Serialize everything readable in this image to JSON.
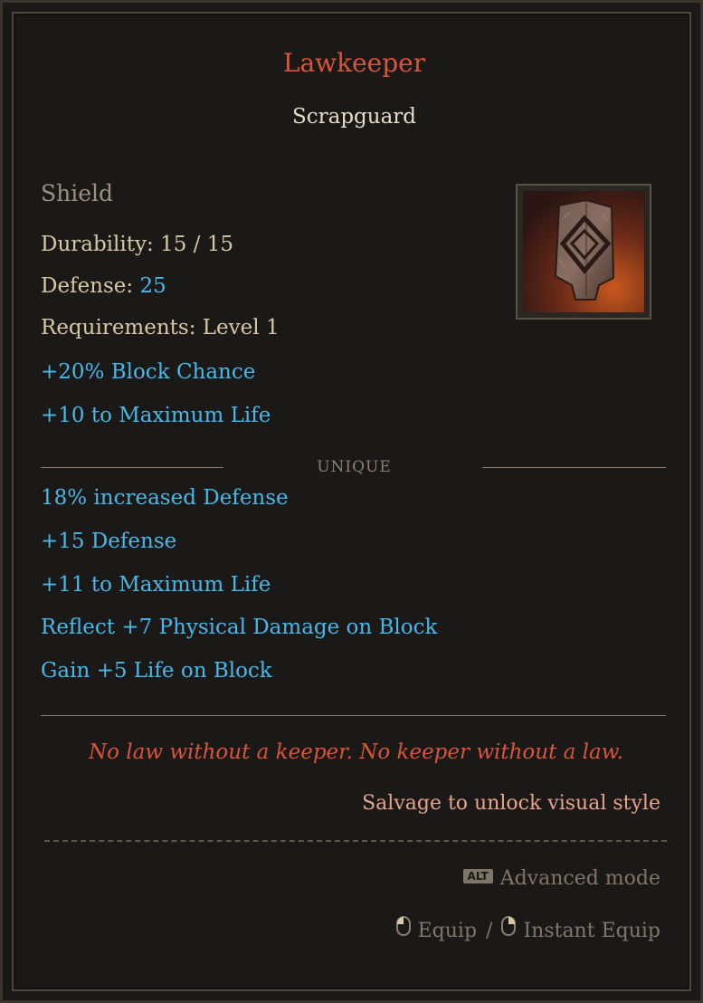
{
  "item": {
    "name": "Lawkeeper",
    "base": "Scrapguard",
    "type": "Shield",
    "icon": "shield-icon"
  },
  "stats": {
    "durability_label": "Durability:",
    "durability_value": "15 / 15",
    "defense_label": "Defense:",
    "defense_value": "25",
    "requirements_label": "Requirements:",
    "requirements_value": "Level 1"
  },
  "implicits": [
    "+20% Block Chance",
    "+10 to Maximum Life"
  ],
  "unique_label": "UNIQUE",
  "affixes": [
    "18% increased Defense",
    "+15 Defense",
    "+11 to Maximum Life",
    "Reflect +7 Physical Damage on Block",
    "Gain +5 Life on Block"
  ],
  "flavor_text": "No law without a keeper. No keeper without a law.",
  "salvage_text": "Salvage to unlock visual style",
  "hints": {
    "alt_key": "ALT",
    "advanced_mode": "Advanced mode",
    "equip": "Equip",
    "separator": "/",
    "instant_equip": "Instant Equip"
  },
  "colors": {
    "unique_name": "#d9553a",
    "magic_blue": "#49b8e8",
    "stat_text": "#d8c7a4",
    "background": "#1b1917"
  }
}
